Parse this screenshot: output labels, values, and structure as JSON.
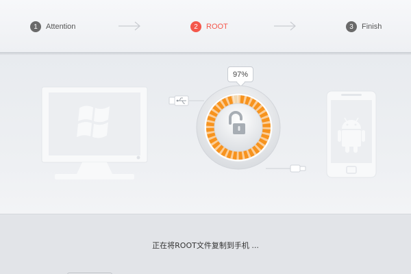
{
  "steps": [
    {
      "number": "1",
      "label": "Attention",
      "state": "done"
    },
    {
      "number": "2",
      "label": "ROOT",
      "state": "active"
    },
    {
      "number": "3",
      "label": "Finish",
      "state": "pending"
    }
  ],
  "progress": {
    "percent_label": "97%",
    "value": 0.97
  },
  "status_text": "正在将ROOT文件复制到手机 ...",
  "colors": {
    "accent": "#f4574b",
    "ring": "#f7931e",
    "step_inactive": "#6a6a6a"
  },
  "icons": [
    "windows-monitor-icon",
    "android-phone-icon",
    "usb-cable-icon",
    "unlock-icon",
    "arrow-right-icon"
  ]
}
